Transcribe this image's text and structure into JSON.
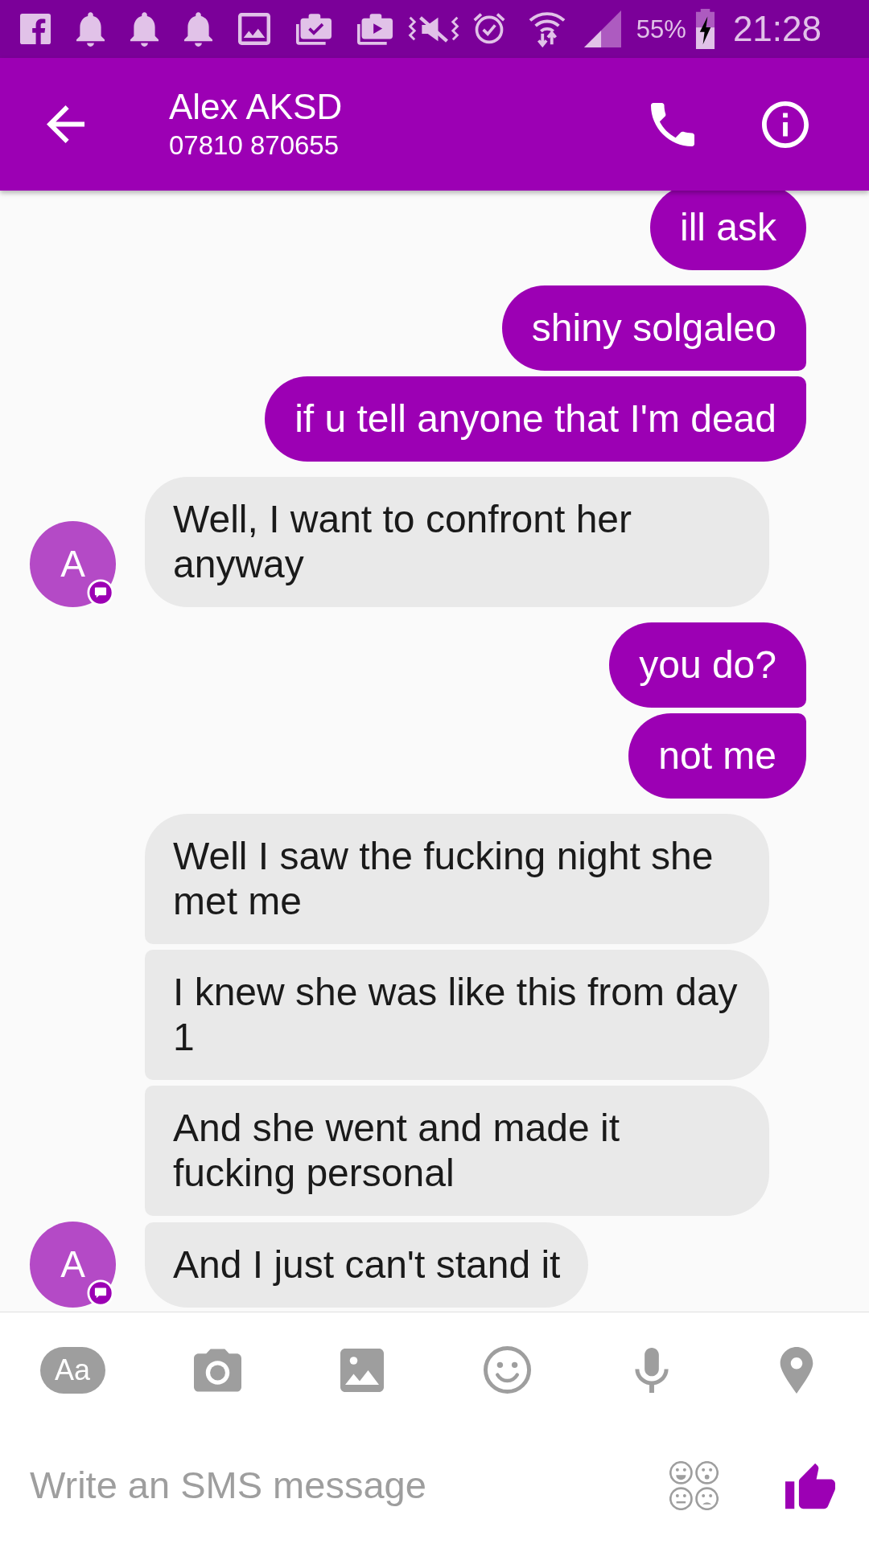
{
  "status_bar": {
    "battery_text": "55%",
    "time": "21:28"
  },
  "header": {
    "title": "Alex AKSD",
    "subtitle": "07810 870655"
  },
  "messages": [
    {
      "kind": "sent",
      "items": [
        "ill ask"
      ]
    },
    {
      "kind": "sent",
      "items": [
        "shiny solgaleo",
        "if u tell anyone that I'm dead"
      ]
    },
    {
      "kind": "received",
      "avatar": "A",
      "items": [
        "Well, I want to confront her anyway"
      ]
    },
    {
      "kind": "sent",
      "items": [
        "you do?",
        "not me"
      ]
    },
    {
      "kind": "received",
      "avatar": "A",
      "items": [
        "Well I saw the fucking night she met me",
        "I knew she was like this from day 1",
        "And she went and made it fucking personal",
        "And I just can't stand it"
      ]
    }
  ],
  "toolbar": [
    {
      "kind": "text",
      "label": "Aa"
    },
    {
      "kind": "camera"
    },
    {
      "kind": "gallery"
    },
    {
      "kind": "emoji"
    },
    {
      "kind": "mic"
    },
    {
      "kind": "location"
    }
  ],
  "composer": {
    "placeholder": "Write an SMS message"
  }
}
